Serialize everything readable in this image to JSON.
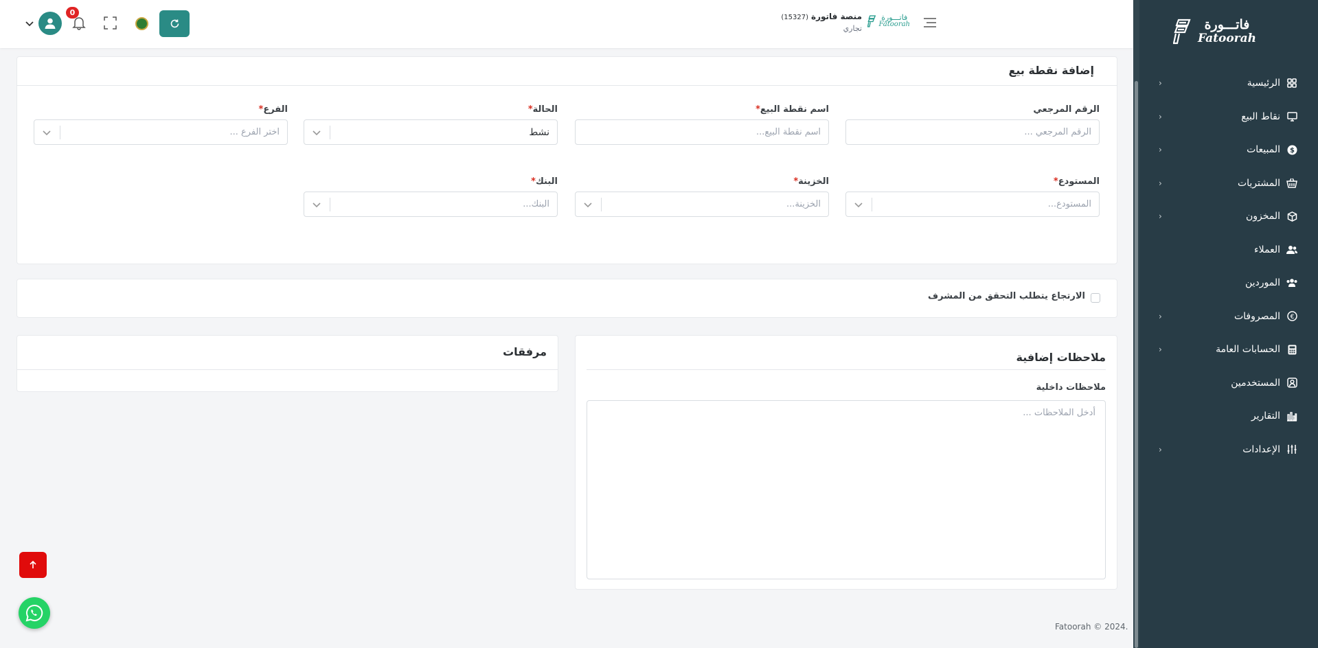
{
  "sidebar": {
    "logo_ar": "فاتـــورة",
    "logo_en": "Fatoorah",
    "items": [
      {
        "label": "الرئيسية",
        "icon": "dashboard-icon",
        "has_children": true
      },
      {
        "label": "نقاط البيع",
        "icon": "monitor-icon",
        "has_children": true
      },
      {
        "label": "المبيعات",
        "icon": "dollar-icon",
        "has_children": true
      },
      {
        "label": "المشتريات",
        "icon": "basket-icon",
        "has_children": true
      },
      {
        "label": "المخزون",
        "icon": "box-icon",
        "has_children": true
      },
      {
        "label": "العملاء",
        "icon": "users-icon",
        "has_children": false
      },
      {
        "label": "الموردين",
        "icon": "group-icon",
        "has_children": false
      },
      {
        "label": "المصروفات",
        "icon": "expense-icon",
        "has_children": true
      },
      {
        "label": "الحسابات العامة",
        "icon": "calculator-icon",
        "has_children": true
      },
      {
        "label": "المستخدمين",
        "icon": "user-square-icon",
        "has_children": false
      },
      {
        "label": "التقارير",
        "icon": "bar-chart-icon",
        "has_children": false
      },
      {
        "label": "الإعدادات",
        "icon": "sliders-icon",
        "has_children": true
      }
    ]
  },
  "topbar": {
    "company_name": "منصة فاتورة",
    "company_number": "(15327)",
    "company_type": "تجاري",
    "brand_ar": "فاتـــورة",
    "brand_en": "Fatoorah",
    "notifications_count": "0"
  },
  "form": {
    "title": "إضافة نقطة بيع",
    "fields": {
      "reference": {
        "label": "الرقم المرجعي",
        "placeholder": "الرقم المرجعي ..."
      },
      "pos_name": {
        "label": "اسم نقطة البيع",
        "placeholder": "اسم نقطة البيع..."
      },
      "status": {
        "label": "الحالة",
        "value": "نشط"
      },
      "branch": {
        "label": "الفرع",
        "placeholder": "اختر الفرع ..."
      },
      "warehouse": {
        "label": "المستودع",
        "placeholder": "المستودع..."
      },
      "treasury": {
        "label": "الخزينة",
        "placeholder": "الخزينة..."
      },
      "bank": {
        "label": "البنك",
        "placeholder": "البنك..."
      }
    }
  },
  "return_check": {
    "label": "الارتجاع يتطلب التحقق من المشرف",
    "checked": false
  },
  "attachments": {
    "title": "مرفقات"
  },
  "notes": {
    "title": "ملاحظات إضافية",
    "internal_label": "ملاحظات داخلية",
    "placeholder": "أدخل الملاحظات ..."
  },
  "footer": {
    "text": "Fatoorah © 2024."
  },
  "colors": {
    "sidebar_bg": "#283c46",
    "accent": "#2a8b85",
    "danger": "#e00b0b",
    "whatsapp": "#25d366"
  }
}
